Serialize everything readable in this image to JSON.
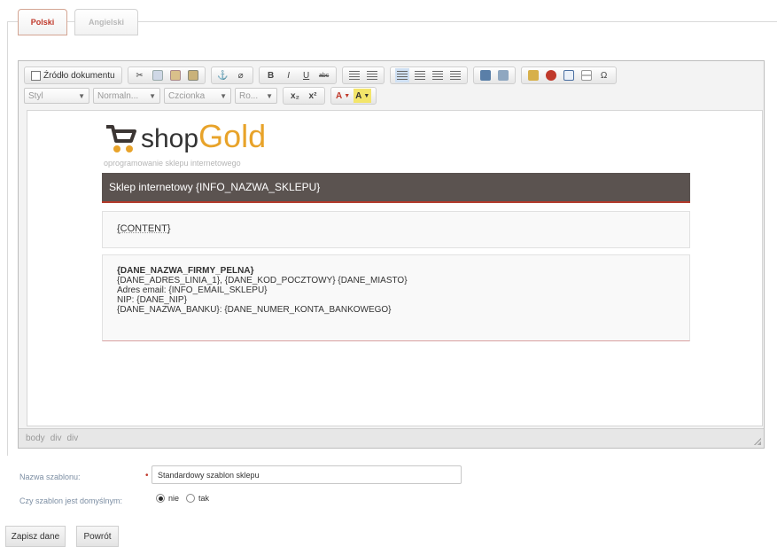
{
  "tabs": [
    {
      "label": "Polski",
      "active": true
    },
    {
      "label": "Angielski",
      "active": false
    }
  ],
  "toolbar": {
    "source_label": "Źródło dokumentu",
    "style_dd": "Styl",
    "format_dd": "Normaln...",
    "font_dd": "Czcionka",
    "size_dd": "Ro...",
    "bold": "B",
    "italic": "I",
    "underline": "U",
    "strike": "abc",
    "sub": "x₂",
    "sup": "x²",
    "text_color": "A",
    "bg_color": "A",
    "special_char": "Ω"
  },
  "document": {
    "brand_shop": "shop",
    "brand_gold": "Gold",
    "tagline": "oprogramowanie sklepu internetowego",
    "header": "Sklep internetowy {INFO_NAZWA_SKLEPU}",
    "content": "{CONTENT}",
    "footer_lines": [
      "{DANE_NAZWA_FIRMY_PELNA}",
      "{DANE_ADRES_LINIA_1}, {DANE_KOD_POCZTOWY} {DANE_MIASTO}",
      "Adres email: {INFO_EMAIL_SKLEPU}",
      "NIP: {DANE_NIP}",
      "{DANE_NAZWA_BANKU}: {DANE_NUMER_KONTA_BANKOWEGO}"
    ]
  },
  "statusbar": {
    "path": [
      "body",
      "div",
      "div"
    ]
  },
  "form": {
    "name_label": "Nazwa szablonu:",
    "name_value": "Standardowy szablon sklepu",
    "default_label": "Czy szablon jest domyślnym:",
    "radio_no": "nie",
    "radio_yes": "tak",
    "default_selected": "nie"
  },
  "buttons": {
    "save": "Zapisz dane",
    "back": "Powrót"
  },
  "colors": {
    "accent": "#c0392b",
    "brand_gold": "#e8a32a",
    "header_bg": "#5b5350"
  }
}
